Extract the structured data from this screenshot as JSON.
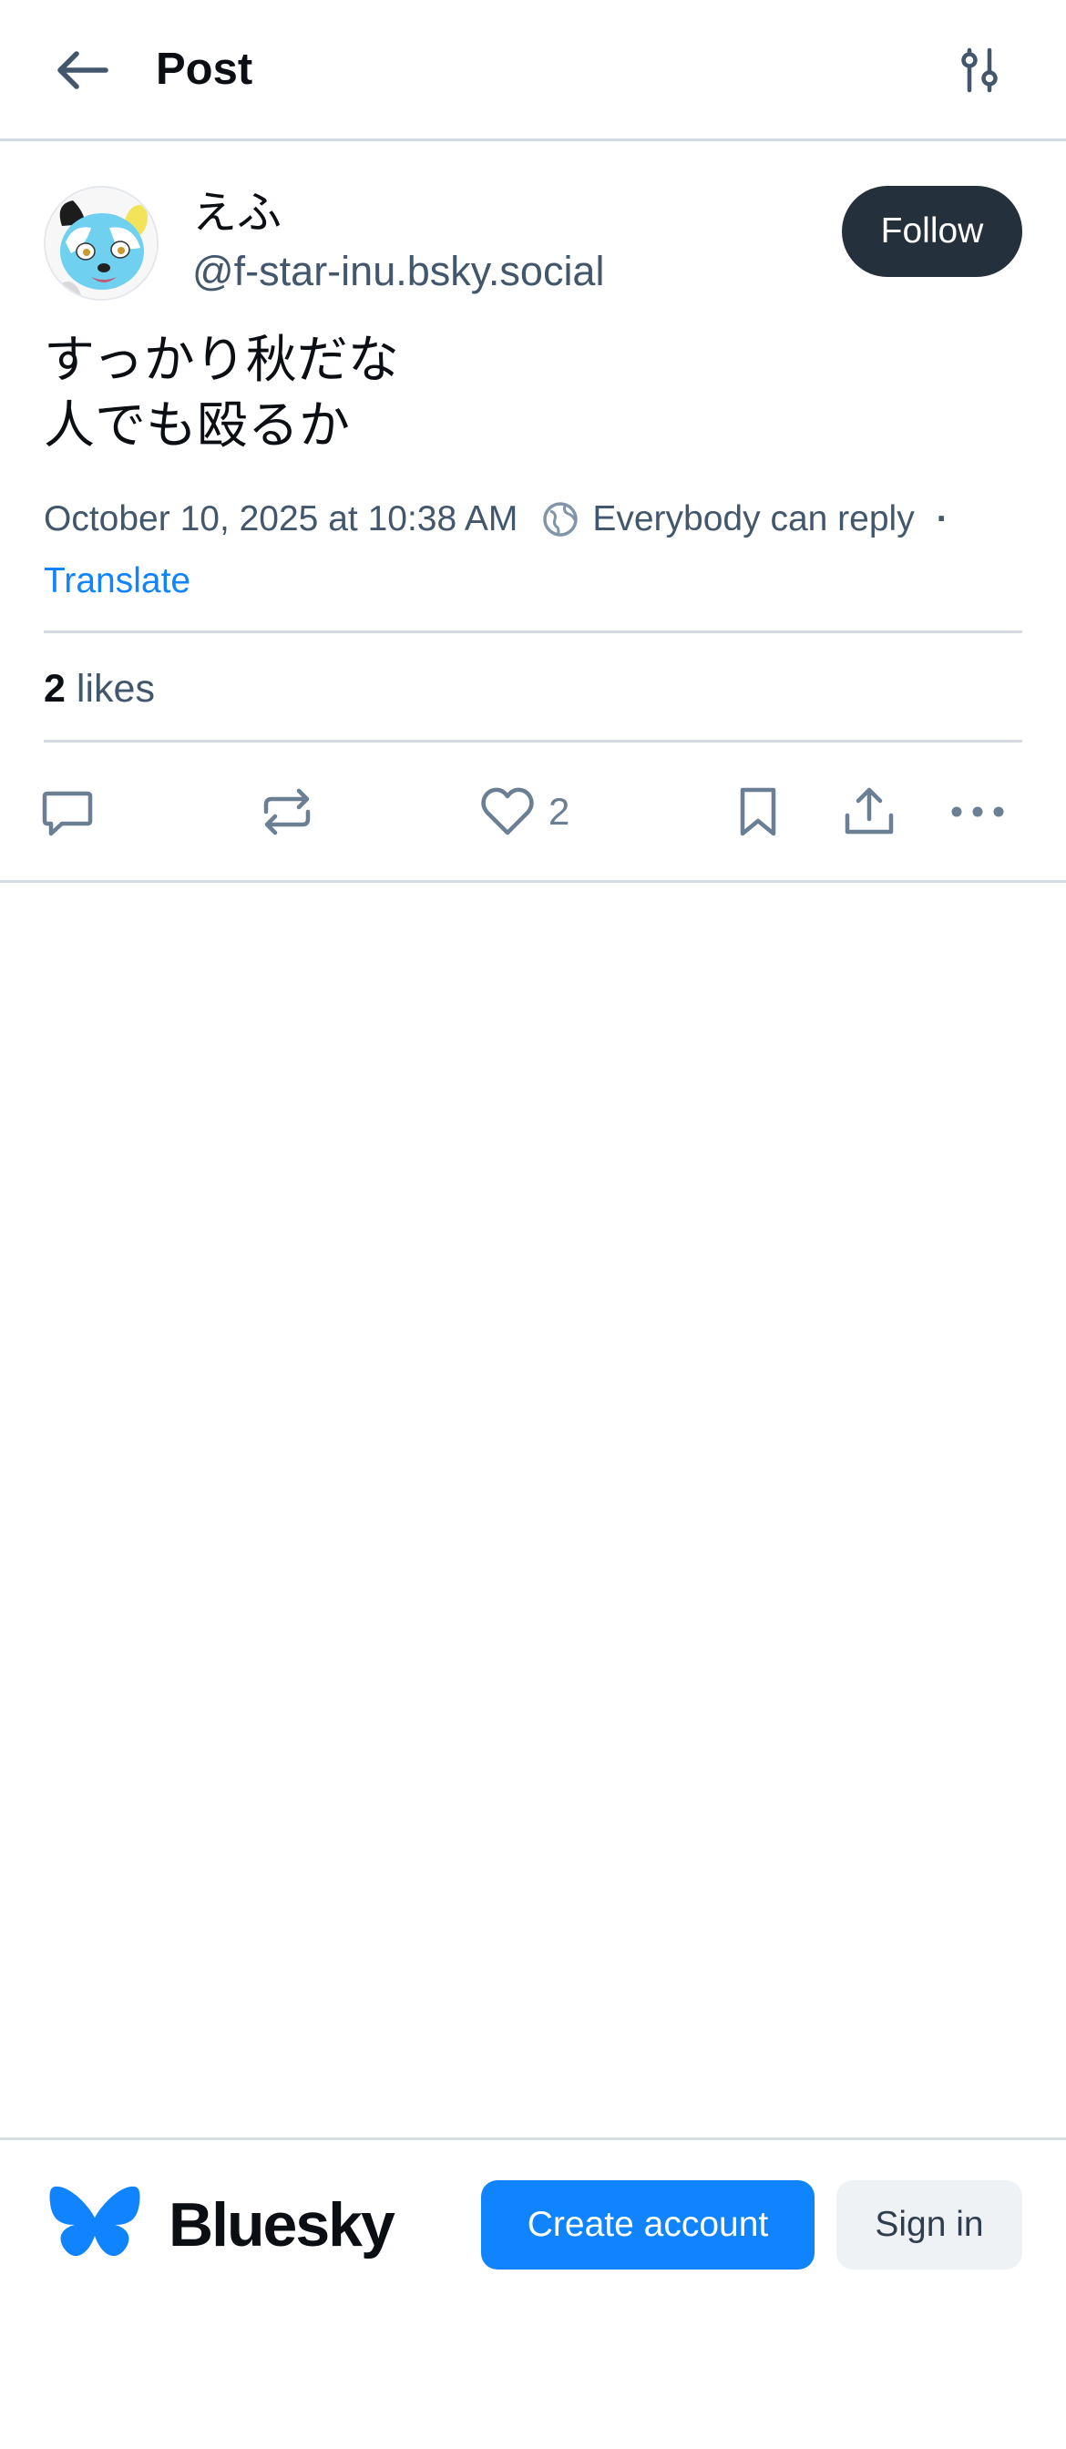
{
  "header": {
    "title": "Post",
    "back_icon": "arrow-left-icon",
    "filter_icon": "sliders-icon"
  },
  "post": {
    "author": {
      "display_name": "えふ",
      "handle": "@f-star-inu.bsky.social",
      "avatar_icon": "avatar-image"
    },
    "follow_label": "Follow",
    "text_lines": [
      "すっかり秋だな",
      "人でも殴るか"
    ],
    "timestamp": "October 10, 2025 at 10:38 AM",
    "reply_setting": "Everybody can reply",
    "separator": "·",
    "translate_label": "Translate",
    "likes": {
      "count": "2",
      "label": "likes"
    },
    "actions": {
      "reply_icon": "speech-bubble-icon",
      "repost_icon": "repost-icon",
      "like_icon": "heart-icon",
      "like_count": "2",
      "bookmark_icon": "bookmark-icon",
      "share_icon": "share-icon",
      "more_icon": "more-dots-icon"
    }
  },
  "footer": {
    "brand": "Bluesky",
    "logo_icon": "butterfly-icon",
    "create_account": "Create account",
    "sign_in": "Sign in"
  },
  "colors": {
    "accent": "#1083fe",
    "text_primary": "#0b0f14",
    "text_secondary": "#42576c",
    "follow_bg": "#25303d",
    "divider": "#d4dbe2"
  }
}
